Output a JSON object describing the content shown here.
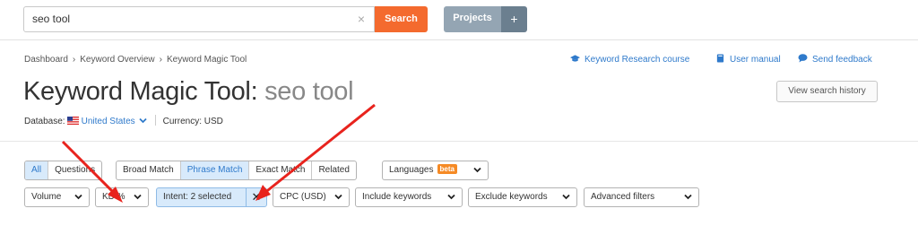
{
  "search": {
    "value": "seo tool",
    "clear": "×",
    "button": "Search"
  },
  "projects": {
    "label": "Projects",
    "plus": "+"
  },
  "breadcrumb": [
    "Dashboard",
    "Keyword Overview",
    "Keyword Magic Tool"
  ],
  "breadcrumb_sep": "›",
  "header_links": {
    "course": "Keyword Research course",
    "manual": "User manual",
    "feedback": "Send feedback"
  },
  "title": {
    "tool": "Keyword Magic Tool:",
    "query": "seo tool"
  },
  "history_button": "View search history",
  "database": {
    "label": "Database:",
    "country": "United States",
    "currency": "Currency: USD"
  },
  "match_tabs": {
    "group1": [
      "All",
      "Questions"
    ],
    "group2": [
      "Broad Match",
      "Phrase Match",
      "Exact Match",
      "Related"
    ],
    "active": [
      "All",
      "Phrase Match"
    ]
  },
  "languages": {
    "label": "Languages",
    "badge": "beta"
  },
  "filters": {
    "volume": "Volume",
    "kd": "KD %",
    "intent": "Intent: 2 selected",
    "intent_clear": "✕",
    "cpc": "CPC (USD)",
    "include": "Include keywords",
    "exclude": "Exclude keywords",
    "advanced": "Advanced filters"
  },
  "colors": {
    "accent": "#2f7acb",
    "search_button": "#f46a2e",
    "projects_button": "#94a5b3",
    "active_tab_bg": "#d8eafb",
    "annotation_arrow": "#e8231d"
  }
}
